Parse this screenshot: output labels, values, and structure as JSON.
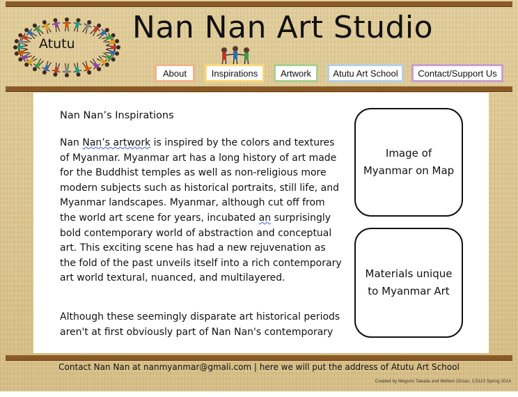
{
  "header": {
    "logo_text": "Atutu",
    "site_title": "Nan Nan Art Studio"
  },
  "nav": {
    "items": [
      {
        "label": "About",
        "border_color": "#f0b48c"
      },
      {
        "label": "Inspirations",
        "border_color": "#f7d97a"
      },
      {
        "label": "Artwork",
        "border_color": "#a9cf8c"
      },
      {
        "label": "Atutu Art School",
        "border_color": "#b6cfe6"
      },
      {
        "label": "Contact/Support Us",
        "border_color": "#c7a0cf"
      }
    ]
  },
  "main": {
    "heading": "Nan Nan’s Inspirations",
    "para1": {
      "start": "Nan ",
      "sq1": "Nan’s  artwork",
      "mid": " is inspired by the colors and textures of Myanmar. Myanmar art has a long history of art made for the Buddhist temples as well as non-religious more modern subjects such as historical portraits, still life, and Myanmar landscapes. Myanmar, although cut off from the world art scene for years, incubated ",
      "sq2": "an",
      "end": " surprisingly bold contemporary world of abstraction and conceptual art. This exciting scene has had a new rejuvenation as the fold of the past unveils itself into a rich contemporary art world textural, nuanced, and multilayered."
    },
    "para2": "Although these seemingly disparate art historical periods aren't at first obviously part of Nan Nan's contemporary",
    "placeholders": [
      "Image of Myanmar on Map",
      "Materials unique to Myanmar Art"
    ]
  },
  "footer": {
    "contact": "Contact Nan Nan at nanmyanmar@gmali.com | here we will put the address of Atutu Art School",
    "credit": "Created by Megumi Takada and Meltem Ozcan, CS110 Spring 2014"
  },
  "colors": {
    "background": "#dcc58f",
    "rule": "#8a5a26",
    "content_bg": "#ffffff"
  },
  "icons": [
    "people-ring-logo-icon",
    "children-figures-icon"
  ]
}
